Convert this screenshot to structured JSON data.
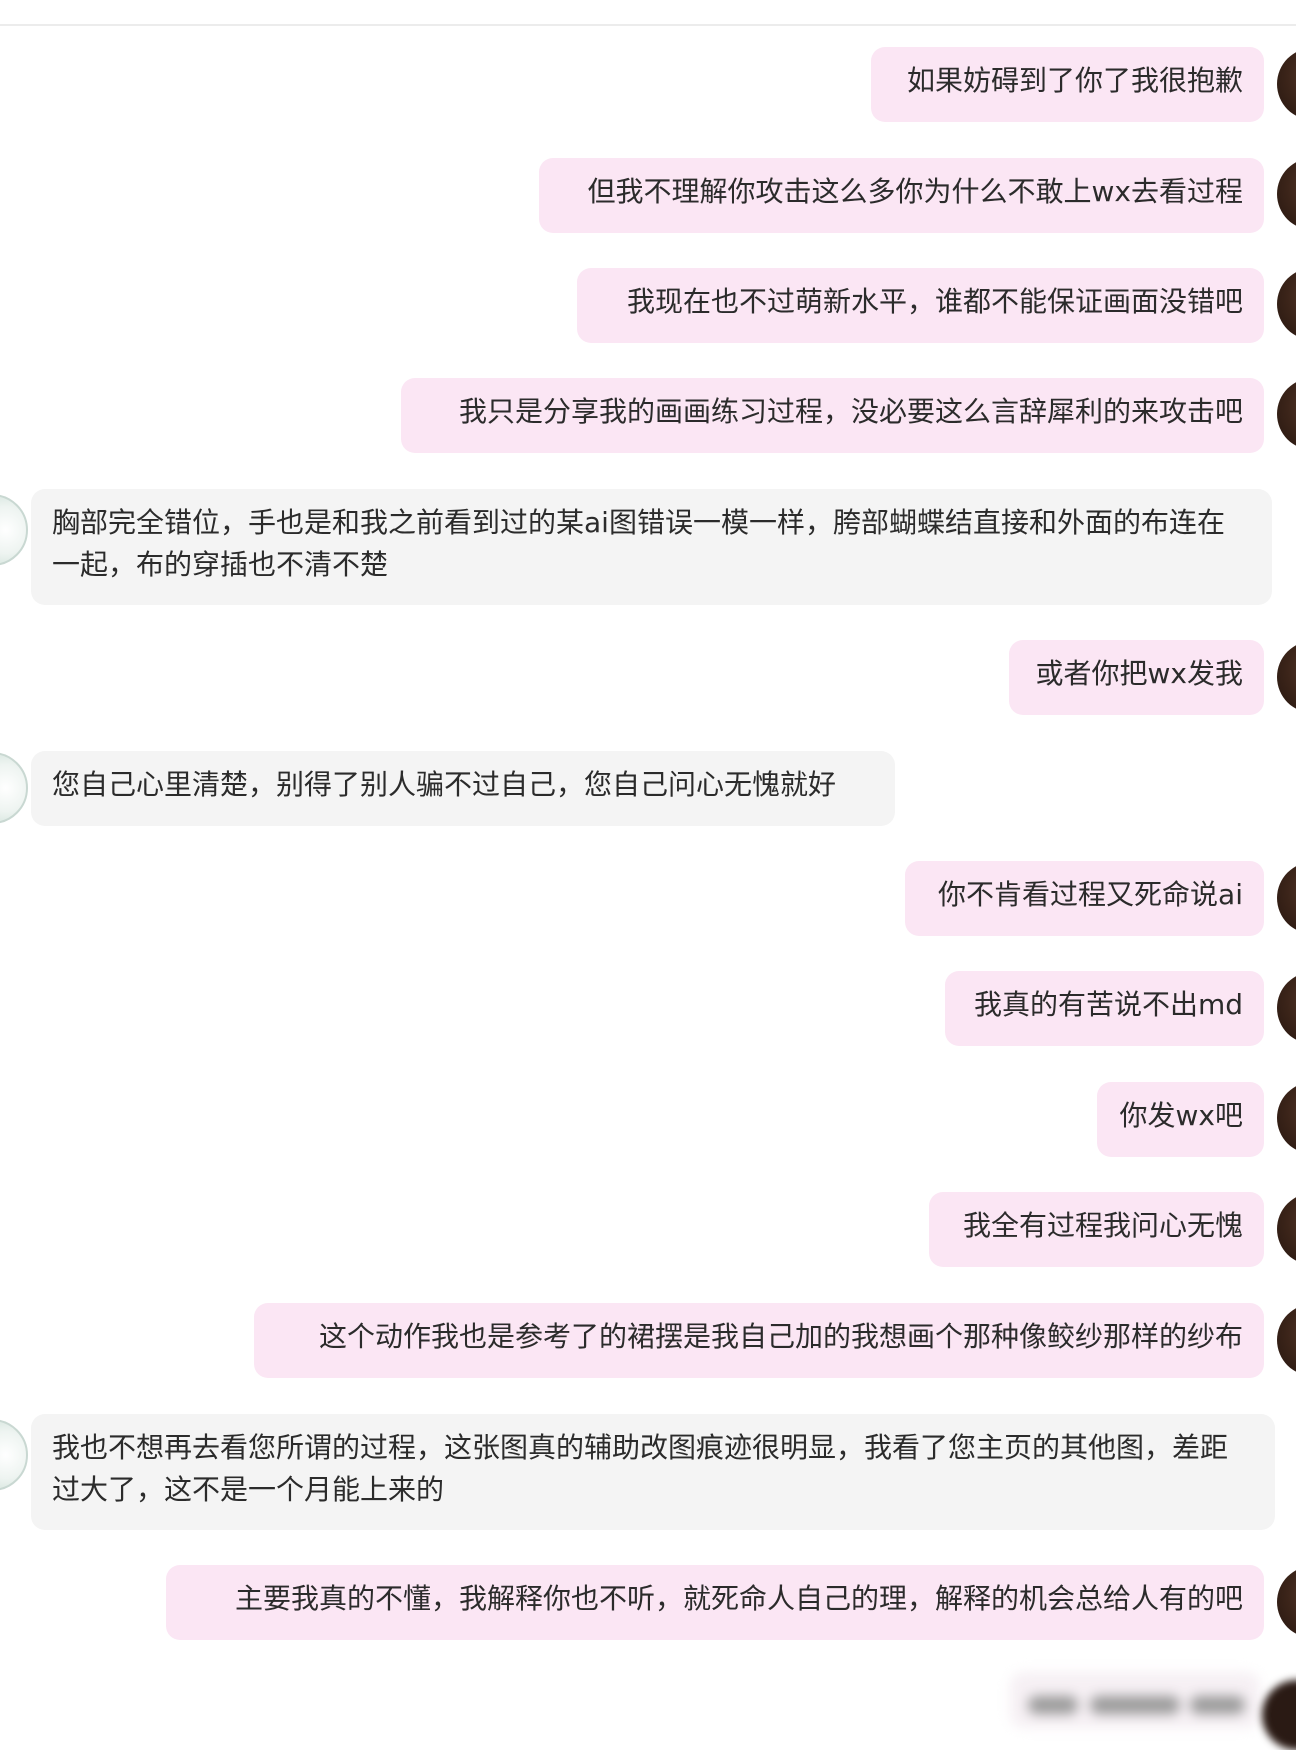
{
  "messages": [
    {
      "direction": "out",
      "text": "如果妨碍到了你了我很抱歉"
    },
    {
      "direction": "out",
      "text": "但我不理解你攻击这么多你为什么不敢上wx去看过程"
    },
    {
      "direction": "out",
      "text": "我现在也不过萌新水平，谁都不能保证画面没错吧"
    },
    {
      "direction": "out",
      "text": "我只是分享我的画画练习过程，没必要这么言辞犀利的来攻击吧"
    },
    {
      "direction": "in",
      "text": "胸部完全错位，手也是和我之前看到过的某ai图错误一模一样，胯部蝴蝶结直接和外面的布连在一起，布的穿插也不清不楚"
    },
    {
      "direction": "out",
      "text": "或者你把wx发我"
    },
    {
      "direction": "in",
      "text": "您自己心里清楚，别得了别人骗不过自己，您自己问心无愧就好"
    },
    {
      "direction": "out",
      "text": "你不肯看过程又死命说ai"
    },
    {
      "direction": "out",
      "text": "我真的有苦说不出md"
    },
    {
      "direction": "out",
      "text": "你发wx吧"
    },
    {
      "direction": "out",
      "text": "我全有过程我问心无愧"
    },
    {
      "direction": "out",
      "text": "这个动作我也是参考了的裙摆是我自己加的我想画个那种像鲛纱那样的纱布"
    },
    {
      "direction": "in",
      "text": "我也不想再去看您所谓的过程，这张图真的辅助改图痕迹很明显，我看了您主页的其他图，差距过大了，这不是一个月能上来的"
    },
    {
      "direction": "out",
      "text": "主要我真的不懂，我解释你也不听，就死命人自己的理，解释的机会总给人有的吧"
    }
  ],
  "colors": {
    "outgoing_bubble": "#fbe6f4",
    "incoming_bubble": "#f4f4f4",
    "text": "#2b2b2b"
  }
}
